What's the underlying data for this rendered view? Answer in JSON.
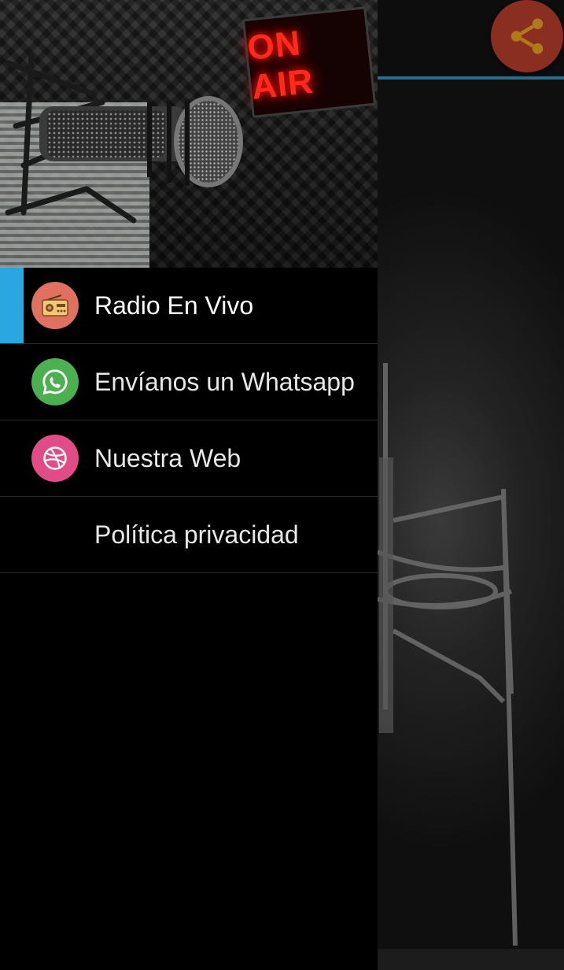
{
  "header": {
    "sign_text": "ON AIR"
  },
  "toolbar": {
    "share_icon": "share-icon",
    "share_color": "#8a2e22"
  },
  "drawer": {
    "active_index": 0,
    "accent_color": "#2aa7e0",
    "items": [
      {
        "label": "Radio En Vivo",
        "icon": "radio-icon",
        "color": "#e0705f"
      },
      {
        "label": "Envíanos un Whatsapp",
        "icon": "whatsapp-icon",
        "color": "#4caf50"
      },
      {
        "label": "Nuestra Web",
        "icon": "dribbble-icon",
        "color": "#e14b86"
      },
      {
        "label": "Política privacidad",
        "icon": "",
        "color": ""
      }
    ]
  }
}
